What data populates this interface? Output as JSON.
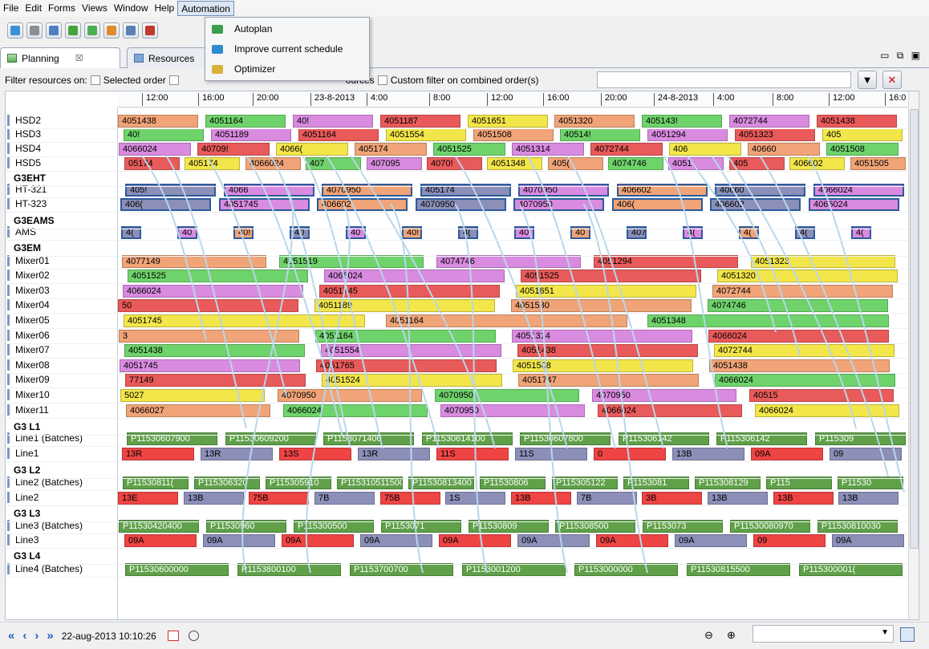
{
  "menu": {
    "items": [
      "File",
      "Edit",
      "Forms",
      "Views",
      "Window",
      "Help",
      "Automation"
    ]
  },
  "automation_menu": {
    "items": [
      "Autoplan",
      "Improve current schedule",
      "Optimizer"
    ]
  },
  "tabs": {
    "planning": "Planning",
    "planning_close": "☒",
    "resources": "Resources"
  },
  "filter": {
    "label": "Filter resources on:",
    "opt_selected": "Selected order",
    "opt_sources": "ources",
    "opt_custom": "Custom filter on combined order(s)"
  },
  "timeline": {
    "ticks": [
      "12:00",
      "16:00",
      "20:00",
      "23-8-2013",
      "4:00",
      "8:00",
      "12:00",
      "16:00",
      "20:00",
      "24-8-2013",
      "4:00",
      "8:00",
      "12:00",
      "16:0"
    ]
  },
  "rows": [
    {
      "label": "HSD2",
      "group": false
    },
    {
      "label": "HSD3",
      "group": false
    },
    {
      "label": "HSD4",
      "group": false
    },
    {
      "label": "HSD5",
      "group": false
    },
    {
      "label": "G3EHT",
      "group": true
    },
    {
      "label": "HT-321",
      "group": false
    },
    {
      "label": "HT-323",
      "group": false
    },
    {
      "label": "G3EAMS",
      "group": true
    },
    {
      "label": "AMS",
      "group": false
    },
    {
      "label": "G3EM",
      "group": true
    },
    {
      "label": "Mixer01",
      "group": false
    },
    {
      "label": "Mixer02",
      "group": false
    },
    {
      "label": "Mixer03",
      "group": false
    },
    {
      "label": "Mixer04",
      "group": false
    },
    {
      "label": "Mixer05",
      "group": false
    },
    {
      "label": "Mixer06",
      "group": false
    },
    {
      "label": "Mixer07",
      "group": false
    },
    {
      "label": "Mixer08",
      "group": false
    },
    {
      "label": "Mixer09",
      "group": false
    },
    {
      "label": "Mixer10",
      "group": false
    },
    {
      "label": "Mixer11",
      "group": false
    },
    {
      "label": "G3 L1",
      "group": true
    },
    {
      "label": "Line1 (Batches)",
      "group": false
    },
    {
      "label": "Line1",
      "group": false
    },
    {
      "label": "G3 L2",
      "group": true
    },
    {
      "label": "Line2 (Batches)",
      "group": false
    },
    {
      "label": "Line2",
      "group": false
    },
    {
      "label": "G3 L3",
      "group": true
    },
    {
      "label": "Line3 (Batches)",
      "group": false
    },
    {
      "label": "Line3",
      "group": false
    },
    {
      "label": "G3 L4",
      "group": true
    },
    {
      "label": "Line4 (Batches)",
      "group": false
    }
  ],
  "bars": [
    [
      "4051438",
      "4051164",
      "40!",
      "4051187",
      "4051651",
      "4051320",
      "405143!",
      "4072744",
      "4051438"
    ],
    [
      "40!",
      "4051189",
      "4051164",
      "4051554",
      "4051508",
      "40514!",
      "4051294",
      "4051323",
      "405"
    ],
    [
      "4066024",
      "40709!",
      "4066(",
      "405174",
      "4051525",
      "4051314",
      "4072744",
      "406",
      "40660",
      "4051508"
    ],
    [
      "05174",
      "405174",
      "4066024",
      "407",
      "407095",
      "4070!",
      "4051348",
      "405(",
      "4074746",
      "4051",
      "405",
      "406602",
      "4051505"
    ],
    [],
    [
      "405!",
      "4066",
      "4070950",
      "405174",
      "4070950",
      "406602",
      "40660",
      "4066024"
    ],
    [
      "406(",
      "4051745",
      "406602",
      "4070950",
      "4070950",
      "406(",
      "406602",
      "4066024"
    ],
    [],
    [
      "4(",
      "40",
      "40!",
      "40",
      "40",
      "40!",
      "4(",
      "40",
      "40",
      "407",
      "4(",
      "4(",
      "4(",
      "4("
    ],
    [],
    [
      "4077149",
      "4051519",
      "4074746",
      "4051294",
      "4051323"
    ],
    [
      "4051525",
      "4066024",
      "4051525",
      "4051320"
    ],
    [
      "4066024",
      "4051745",
      "4051651",
      "4072744"
    ],
    [
      "50",
      "4051189",
      "4051530",
      "4074746"
    ],
    [
      "4051745",
      "4051164",
      "4051348"
    ],
    [
      "3",
      "4051164",
      "4051314",
      "4066024"
    ],
    [
      "4051438",
      "4051554",
      "4051438",
      "4072744"
    ],
    [
      "4051745",
      "4051765",
      "4051508",
      "4051438"
    ],
    [
      "77149",
      "4051524",
      "4051747",
      "4066024"
    ],
    [
      "5027",
      "4070950",
      "4070950",
      "4070950",
      "40515"
    ],
    [
      "4066027",
      "4066024",
      "4070950",
      "4066024",
      "4066024"
    ],
    [],
    [
      "P11530607900",
      "P11530609200",
      "P1153071400",
      "P11530614100",
      "P11530607800",
      "P115306142",
      "P115306142",
      "P115309"
    ],
    [
      "13R",
      "13R",
      "13S",
      "13R",
      "11S",
      "11S",
      "0",
      "13B",
      "09A",
      "09"
    ],
    [],
    [
      "P11530811(",
      "P115306320",
      "P115305910",
      "P115310511500",
      "P11530813400",
      "P11530806",
      "P115305122",
      "P1153081",
      "P115308129",
      "P115",
      "P11530"
    ],
    [
      "13E",
      "13B",
      "75B",
      "7B",
      "75B",
      "1S",
      "13B",
      "7B",
      "3B",
      "13B",
      "13B",
      "13B"
    ],
    [],
    [
      "P11530420400",
      "P11530960",
      "P115300500",
      "P1153071",
      "P11530809",
      "P115308500",
      "P1153073",
      "P11530080970",
      "P11530810030"
    ],
    [
      "09A",
      "09A",
      "09A",
      "09A",
      "09A",
      "09A",
      "09A",
      "09A",
      "09",
      "09A"
    ],
    [],
    [
      "P11530600000",
      "P1153800100",
      "P1153700700",
      "P1153001200",
      "P1153000000",
      "P11530815500",
      "P115300001("
    ]
  ],
  "status": {
    "datetime": "22-aug-2013 10:10:26"
  }
}
